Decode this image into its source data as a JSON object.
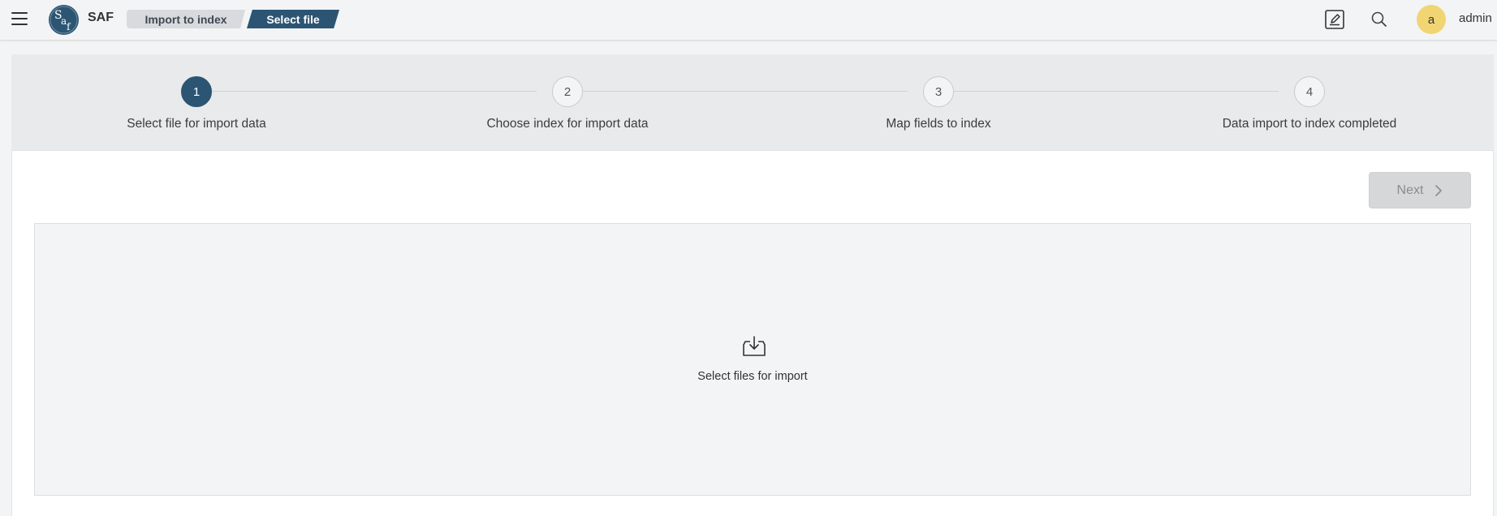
{
  "app": {
    "name": "SAF",
    "logo_text": "Saf",
    "accent_color": "#2c5573"
  },
  "header": {
    "breadcrumbs": [
      {
        "label": "Import to index"
      },
      {
        "label": "Select file"
      }
    ],
    "icons": [
      "menu-icon",
      "edit-icon",
      "search-icon"
    ],
    "user": {
      "avatar_letter": "a",
      "name": "admin",
      "avatar_color": "#f0d572"
    }
  },
  "stepper": {
    "steps": [
      {
        "number": "1",
        "label": "Select file for import data",
        "active": true
      },
      {
        "number": "2",
        "label": "Choose index for import data",
        "active": false
      },
      {
        "number": "3",
        "label": "Map fields to index",
        "active": false
      },
      {
        "number": "4",
        "label": "Data import to index completed",
        "active": false
      }
    ]
  },
  "actions": {
    "next_label": "Next",
    "next_icon": "chevron-right-icon"
  },
  "dropzone": {
    "icon": "download-tray-icon",
    "label": "Select files for import"
  }
}
